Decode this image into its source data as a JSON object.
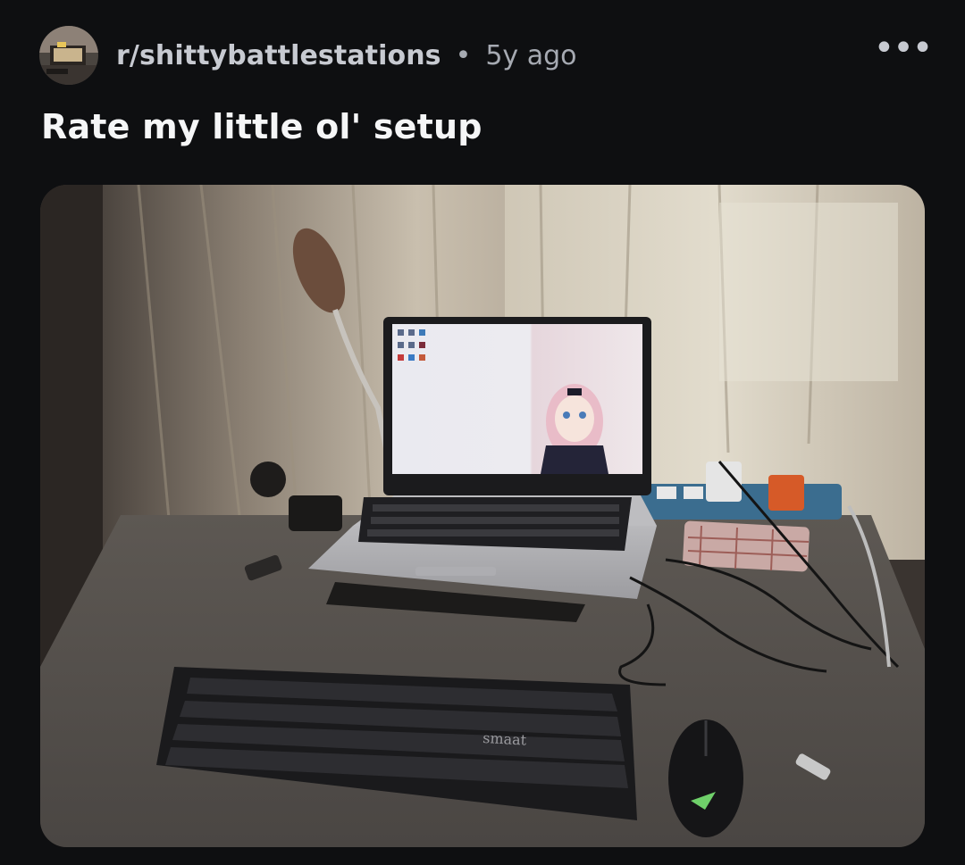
{
  "post": {
    "community": "r/shittybattlestations",
    "separator": "•",
    "age": "5y ago",
    "more_icon": "more-horizontal-icon",
    "title": "Rate my little ol' setup"
  },
  "photo": {
    "keyboard_brand": "smaat"
  },
  "colors": {
    "background": "#0e0f11",
    "community_text": "#c7cad1",
    "title_text": "#f5f6f7",
    "meta_text": "#a6aab2"
  }
}
